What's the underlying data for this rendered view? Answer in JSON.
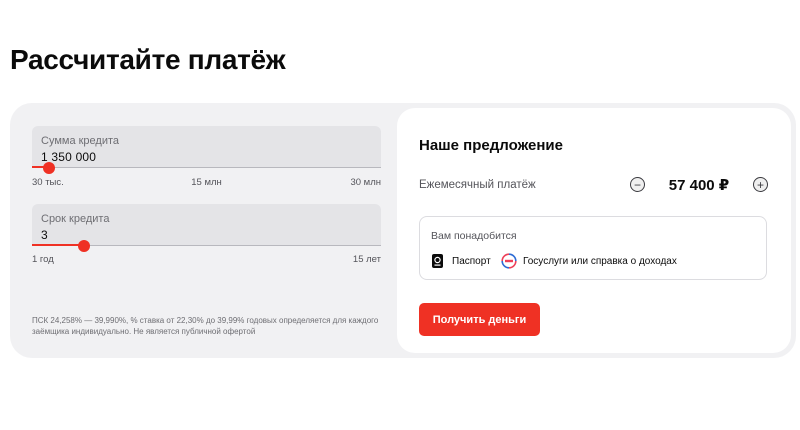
{
  "page": {
    "title": "Рассчитайте платёж"
  },
  "calculator": {
    "amount": {
      "label": "Сумма кредита",
      "value": "1 350 000",
      "slider_fraction": 0.05,
      "scale": {
        "min": "30 тыс.",
        "mid": "15 млн",
        "max": "30 млн"
      }
    },
    "term": {
      "label": "Срок кредита",
      "value": "3",
      "slider_fraction": 0.15,
      "scale": {
        "min": "1 год",
        "max": "15 лет"
      }
    },
    "disclaimer": "ПСК 24,258% — 39,990%, % ставка от 22,30% до 39,99% годовых определяется для каждого заёмщика индивидуально. Не является публичной офертой"
  },
  "offer": {
    "title": "Наше предложение",
    "monthly_label": "Ежемесячный платёж",
    "monthly_value": "57 400 ₽",
    "minus_icon": "minus-icon",
    "plus_icon": "plus-icon",
    "needs": {
      "title": "Вам понадобится",
      "items": [
        {
          "icon": "passport-icon",
          "label": "Паспорт"
        },
        {
          "icon": "gosuslugi-icon",
          "label": "Госуслуги или справка о доходах"
        }
      ]
    },
    "cta_label": "Получить деньги"
  },
  "colors": {
    "accent": "#ef3124",
    "card_bg": "#f1f1f3",
    "field_bg": "#e4e4e7",
    "text": "#0b0b0b",
    "muted": "#6e6e73"
  }
}
